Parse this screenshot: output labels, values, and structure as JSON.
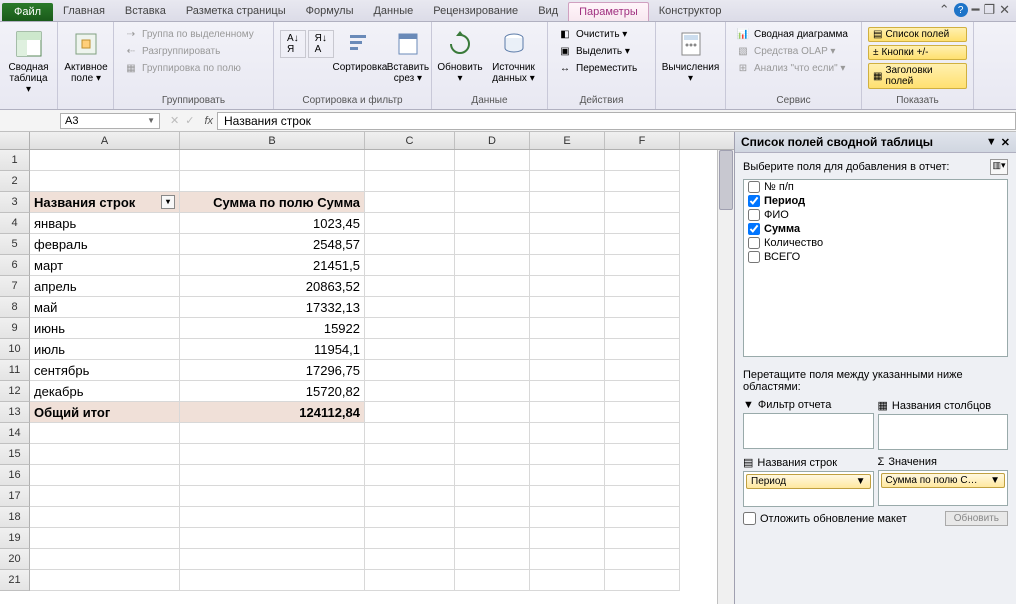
{
  "tabs": {
    "file": "Файл",
    "items": [
      "Главная",
      "Вставка",
      "Разметка страницы",
      "Формулы",
      "Данные",
      "Рецензирование",
      "Вид",
      "Параметры",
      "Конструктор"
    ],
    "active_index": 7
  },
  "ribbon": {
    "group1": {
      "btn1": "Сводная\nтаблица ▾",
      "btn2": "Активное\nполе ▾"
    },
    "group2": {
      "label": "Группировать",
      "b1": "Группа по выделенному",
      "b2": "Разгруппировать",
      "b3": "Группировка по полю"
    },
    "group3": {
      "label": "Сортировка и фильтр",
      "sort_az": "А↓",
      "sort_za": "Я↓",
      "sort": "Сортировка",
      "slicer": "Вставить\nсрез ▾"
    },
    "group4": {
      "label": "Данные",
      "refresh": "Обновить\n▾",
      "source": "Источник\nданных ▾"
    },
    "group5": {
      "label": "Действия",
      "clear": "Очистить ▾",
      "select": "Выделить ▾",
      "move": "Переместить"
    },
    "group6": {
      "calc": "Вычисления\n▾"
    },
    "group7": {
      "label": "Сервис",
      "chart": "Сводная диаграмма",
      "olap": "Средства OLAP ▾",
      "whatif": "Анализ \"что если\" ▾"
    },
    "group8": {
      "label": "Показать",
      "b1": "Список полей",
      "b2": "Кнопки +/-",
      "b3": "Заголовки полей"
    }
  },
  "namebox": "A3",
  "formula": "Названия строк",
  "columns": [
    "A",
    "B",
    "C",
    "D",
    "E",
    "F"
  ],
  "pivot": {
    "header_row_label": "Названия строк",
    "header_value_label": "Сумма по полю Сумма",
    "rows": [
      {
        "label": "январь",
        "value": "1023,45"
      },
      {
        "label": "февраль",
        "value": "2548,57"
      },
      {
        "label": "март",
        "value": "21451,5"
      },
      {
        "label": "апрель",
        "value": "20863,52"
      },
      {
        "label": "май",
        "value": "17332,13"
      },
      {
        "label": "июнь",
        "value": "15922"
      },
      {
        "label": "июль",
        "value": "11954,1"
      },
      {
        "label": "сентябрь",
        "value": "17296,75"
      },
      {
        "label": "декабрь",
        "value": "15720,82"
      }
    ],
    "total_label": "Общий итог",
    "total_value": "124112,84"
  },
  "fieldpane": {
    "title": "Список полей сводной таблицы",
    "subtitle": "Выберите поля для добавления в отчет:",
    "fields": [
      {
        "name": "№ п/п",
        "checked": false
      },
      {
        "name": "Период",
        "checked": true
      },
      {
        "name": "ФИО",
        "checked": false
      },
      {
        "name": "Сумма",
        "checked": true
      },
      {
        "name": "Количество",
        "checked": false
      },
      {
        "name": "ВСЕГО",
        "checked": false
      }
    ],
    "drag_instr": "Перетащите поля между указанными ниже областями:",
    "area_filter": "Фильтр отчета",
    "area_cols": "Названия столбцов",
    "area_rows": "Названия строк",
    "area_vals": "Значения",
    "row_item": "Период",
    "val_item": "Сумма по полю С…",
    "defer": "Отложить обновление макет",
    "update": "Обновить"
  }
}
